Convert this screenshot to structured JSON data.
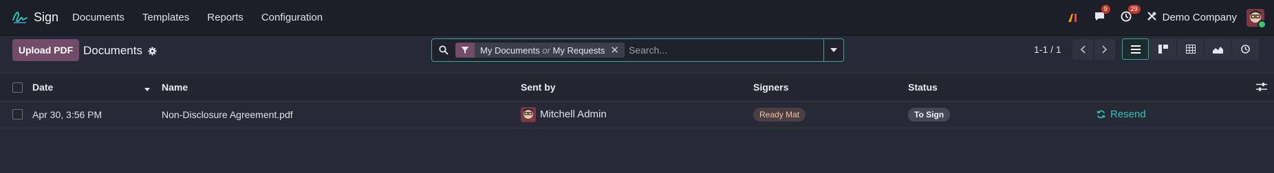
{
  "app": {
    "name": "Sign"
  },
  "menu": [
    "Documents",
    "Templates",
    "Reports",
    "Configuration"
  ],
  "systray": {
    "ai_icon": "ai-icon",
    "messages_count": "9",
    "activities_count": "29",
    "company": "Demo Company"
  },
  "controls": {
    "upload_label": "Upload PDF",
    "breadcrumb": "Documents",
    "search": {
      "facet_first": "My Documents",
      "facet_or": "or",
      "facet_second": "My Requests",
      "placeholder": "Search..."
    },
    "pager": "1-1 / 1",
    "views": [
      "list",
      "kanban",
      "pivot",
      "graph",
      "activity"
    ],
    "active_view": "list"
  },
  "table": {
    "columns": [
      "Date",
      "Name",
      "Sent by",
      "Signers",
      "Status"
    ],
    "rows": [
      {
        "date": "Apr 30, 3:56 PM",
        "name": "Non-Disclosure Agreement.pdf",
        "sent_by": "Mitchell Admin",
        "signer": "Ready Mat",
        "status": "To Sign",
        "action": "Resend"
      }
    ]
  },
  "colors": {
    "brand": "#714b67",
    "accent": "#2ec4b6",
    "background": "#262a36",
    "topbar": "#1c1f27"
  }
}
